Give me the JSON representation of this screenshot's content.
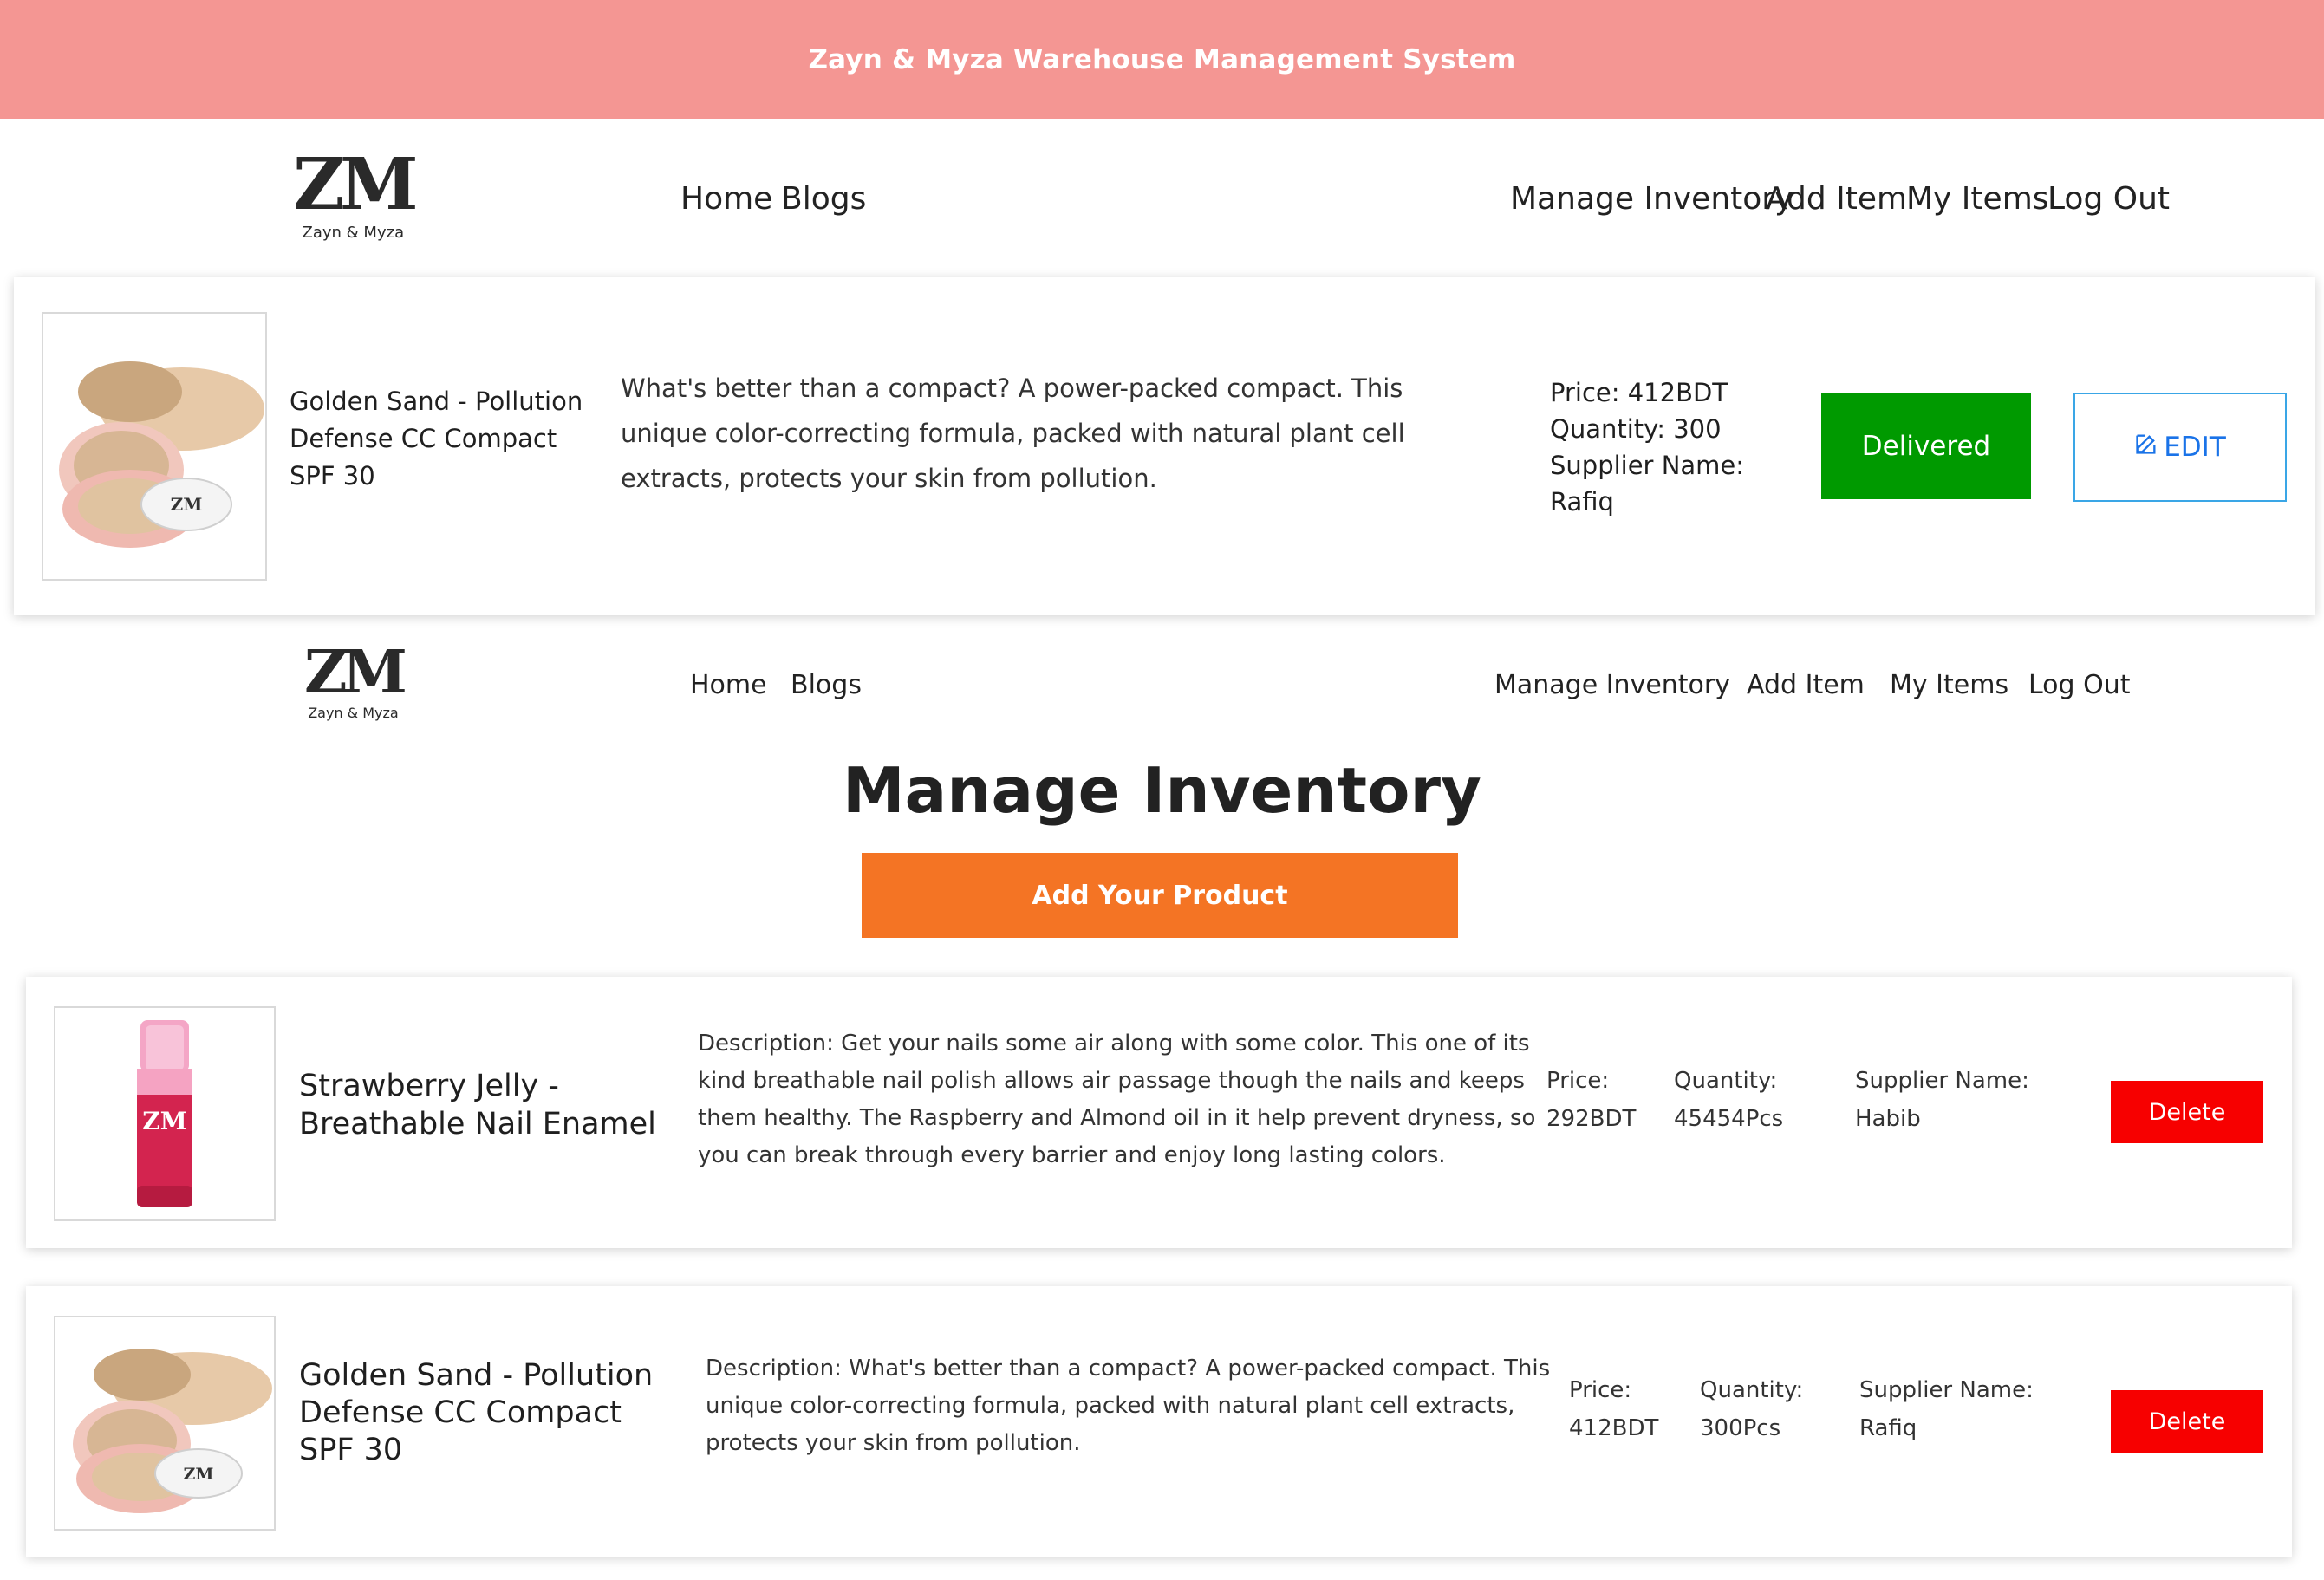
{
  "banner": {
    "title": "Zayn & Myza Warehouse Management System"
  },
  "brand": {
    "mark": "ZM",
    "name": "Zayn & Myza"
  },
  "nav": {
    "home": "Home",
    "blogs": "Blogs",
    "manage_inventory": "Manage Inventory",
    "add_item": "Add Item",
    "my_items": "My Items",
    "log_out": "Log Out"
  },
  "detail": {
    "name": "Golden Sand - Pollution Defense CC Compact SPF 30",
    "description": "What's better than a compact? A power-packed compact. This unique color-correcting formula, packed with natural plant cell extracts, protects your skin from pollution.",
    "price": "Price: 412BDT",
    "quantity": "Quantity: 300",
    "supplier": "Supplier Name: Rafiq",
    "delivered_label": "Delivered",
    "edit_label": "EDIT"
  },
  "manage": {
    "title": "Manage Inventory",
    "add_label": "Add Your Product",
    "items": [
      {
        "name": "Strawberry Jelly - Breathable Nail Enamel",
        "description": "Description: Get your nails some air along with some color. This one of its kind breathable nail polish allows air passage though the nails and keeps them healthy. The Raspberry and Almond oil in it help prevent dryness, so you can break through every barrier and enjoy long lasting colors.",
        "price_label": "Price:",
        "price": "292BDT",
        "quantity_label": "Quantity:",
        "quantity": "45454Pcs",
        "supplier_label": "Supplier Name:",
        "supplier": "Habib",
        "delete_label": "Delete"
      },
      {
        "name": "Golden Sand - Pollution Defense CC Compact SPF 30",
        "description": "Description: What's better than a compact? A power-packed compact. This unique color-correcting formula, packed with natural plant cell extracts, protects your skin from pollution.",
        "price_label": "Price:",
        "price": "412BDT",
        "quantity_label": "Quantity:",
        "quantity": "300Pcs",
        "supplier_label": "Supplier Name:",
        "supplier": "Rafiq",
        "delete_label": "Delete"
      }
    ]
  },
  "colors": {
    "banner": "#f49693",
    "delivered": "#009a00",
    "edit_border": "#3aa6e6",
    "add_button": "#f47424",
    "delete_button": "#f70000"
  },
  "icons": {
    "edit": "edit-icon"
  }
}
